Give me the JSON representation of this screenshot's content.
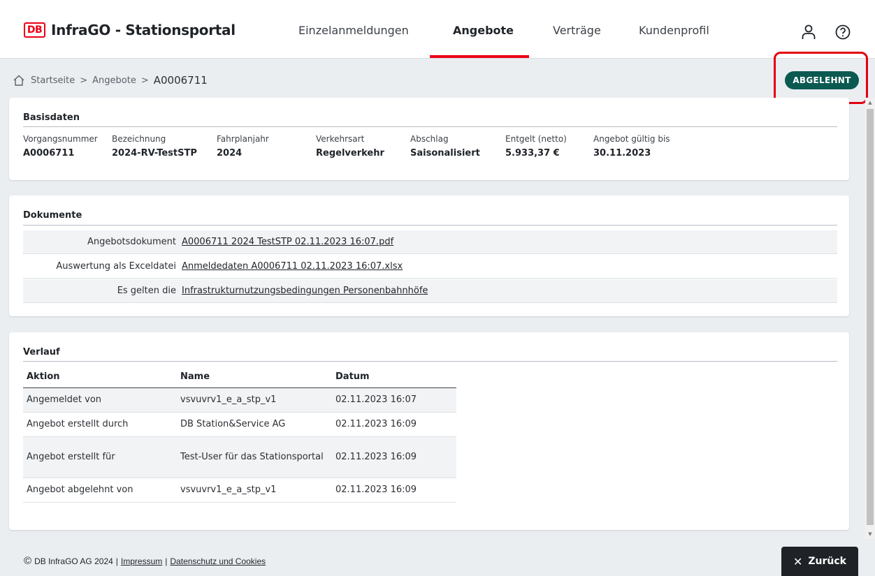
{
  "header": {
    "logo_badge": "DB",
    "brand": "InfraGO - Stationsportal",
    "nav": [
      {
        "label": "Einzelanmeldungen"
      },
      {
        "label": "Angebote"
      },
      {
        "label": "Verträge"
      },
      {
        "label": "Kundenprofil"
      }
    ],
    "icons": [
      "user-icon",
      "help-icon"
    ]
  },
  "breadcrumb": {
    "items": [
      "Startseite",
      "Angebote"
    ],
    "current": "A0006711",
    "separator": ">"
  },
  "status": {
    "label": "ABGELEHNT",
    "color": "#0b5a52"
  },
  "basisdaten": {
    "title": "Basisdaten",
    "fields": [
      {
        "label": "Vorgangsnummer",
        "value": "A0006711"
      },
      {
        "label": "Bezeichnung",
        "value": "2024-RV-TestSTP"
      },
      {
        "label": "Fahrplanjahr",
        "value": "2024"
      },
      {
        "label": "Verkehrsart",
        "value": "Regelverkehr"
      },
      {
        "label": "Abschlag",
        "value": "Saisonalisiert"
      },
      {
        "label": "Entgelt (netto)",
        "value": "5.933,37 €"
      },
      {
        "label": "Angebot gültig bis",
        "value": "30.11.2023"
      }
    ]
  },
  "dokumente": {
    "title": "Dokumente",
    "rows": [
      {
        "label": "Angebotsdokument",
        "link": "A0006711 2024 TestSTP 02.11.2023 16:07.pdf"
      },
      {
        "label": "Auswertung als Exceldatei",
        "link": "Anmeldedaten A0006711 02.11.2023 16:07.xlsx"
      },
      {
        "label": "Es gelten die",
        "link": "Infrastrukturnutzungsbedingungen Personenbahnhöfe"
      }
    ]
  },
  "verlauf": {
    "title": "Verlauf",
    "columns": [
      "Aktion",
      "Name",
      "Datum"
    ],
    "rows": [
      {
        "aktion": "Angemeldet von",
        "name": "vsvuvrv1_e_a_stp_v1",
        "datum": "02.11.2023 16:07"
      },
      {
        "aktion": "Angebot erstellt durch",
        "name": "DB Station&Service AG",
        "datum": "02.11.2023 16:09"
      },
      {
        "aktion": "Angebot erstellt für",
        "name": "Test-User für das Stationsportal",
        "datum": "02.11.2023 16:09"
      },
      {
        "aktion": "Angebot abgelehnt von",
        "name": "vsvuvrv1_e_a_stp_v1",
        "datum": "02.11.2023 16:09"
      }
    ]
  },
  "footer": {
    "copyright_symbol": "©",
    "copyright": "DB InfraGO AG 2024",
    "links": [
      "Impressum",
      "Datenschutz und Cookies"
    ],
    "separator": "|"
  },
  "back_button": {
    "icon": "close-icon",
    "glyph": "✕",
    "label": "Zurück"
  },
  "colors": {
    "accent": "#ec0016",
    "brand_dark": "#1f2328",
    "status_green": "#0b5a52",
    "highlight": "#e3000f"
  }
}
